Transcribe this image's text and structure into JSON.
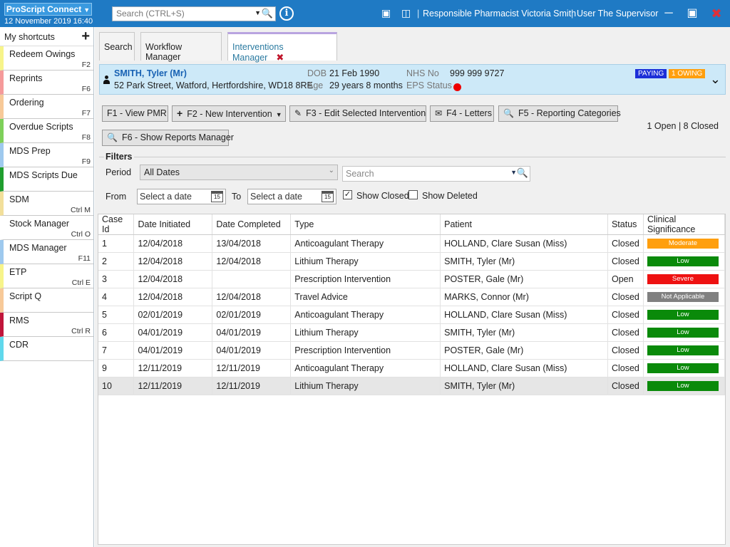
{
  "app": {
    "title": "ProScript Connect",
    "datetime": "12 November 2019 16:40"
  },
  "search": {
    "placeholder": "Search (CTRL+S)"
  },
  "header": {
    "pharmacist": "Responsible Pharmacist Victoria Smith",
    "user": "User The Supervisor"
  },
  "sidebar": {
    "title": "My shortcuts",
    "items": [
      {
        "label": "Redeem Owings",
        "key": "F2",
        "color": "#f7f48a"
      },
      {
        "label": "Reprints",
        "key": "F6",
        "color": "#f59a9a"
      },
      {
        "label": "Ordering",
        "key": "F7",
        "color": "#f7c998"
      },
      {
        "label": "Overdue Scripts",
        "key": "F8",
        "color": "#7ed05a"
      },
      {
        "label": "MDS Prep",
        "key": "F9",
        "color": "#9ec9ee"
      },
      {
        "label": "MDS Scripts Due",
        "key": "",
        "color": "#1f9e2e"
      },
      {
        "label": "SDM",
        "key": "Ctrl M",
        "color": "#f2df9a"
      },
      {
        "label": "Stock Manager",
        "key": "Ctrl O",
        "color": "#ffffff"
      },
      {
        "label": "MDS Manager",
        "key": "F11",
        "color": "#9ec9ee"
      },
      {
        "label": "ETP",
        "key": "Ctrl E",
        "color": "#f7f48a"
      },
      {
        "label": "Script Q",
        "key": "",
        "color": "#f7c998"
      },
      {
        "label": "RMS",
        "key": "Ctrl R",
        "color": "#c0153a"
      },
      {
        "label": "CDR",
        "key": "",
        "color": "#60d8ec"
      }
    ]
  },
  "tabs": [
    "Search",
    "Workflow Manager",
    "Interventions Manager"
  ],
  "patient": {
    "name": "SMITH, Tyler (Mr)",
    "address": "52 Park Street, Watford, Hertfordshire, WD18 8RE",
    "dob_label": "DOB",
    "dob": "21 Feb 1990",
    "age_label": "Age",
    "age": "29 years 8 months",
    "nhs_label": "NHS No",
    "nhs": "999 999 9727",
    "eps_label": "EPS Status",
    "badge_paying": "PAYING",
    "badge_owing": "1 OWING"
  },
  "toolbar": {
    "view_pmr": "F1 - View PMR",
    "new_intervention": "F2 - New Intervention",
    "edit": "F3 - Edit Selected Intervention",
    "letters": "F4 - Letters",
    "reporting": "F5 - Reporting Categories",
    "reports_manager": "F6 - Show Reports Manager",
    "counts": "1 Open | 8 Closed"
  },
  "filters": {
    "title": "Filters",
    "period_label": "Period",
    "period_value": "All Dates",
    "search_placeholder": "Search",
    "from_label": "From",
    "to_label": "To",
    "from_placeholder": "Select a date",
    "to_placeholder": "Select a date",
    "cal_day": "15",
    "show_closed": "Show Closed",
    "show_deleted": "Show Deleted"
  },
  "table": {
    "columns": [
      "Case Id",
      "Date Initiated",
      "Date Completed",
      "Type",
      "Patient",
      "Status",
      "Clinical Significance"
    ],
    "rows": [
      {
        "id": "1",
        "initiated": "12/04/2018",
        "completed": "13/04/2018",
        "type": "Anticoagulant Therapy",
        "patient": "HOLLAND, Clare Susan (Miss)",
        "status": "Closed",
        "sig": "Moderate",
        "sig_color": "#ff9f0e"
      },
      {
        "id": "2",
        "initiated": "12/04/2018",
        "completed": "12/04/2018",
        "type": "Lithium Therapy",
        "patient": "SMITH, Tyler (Mr)",
        "status": "Closed",
        "sig": "Low",
        "sig_color": "#0a8a0a"
      },
      {
        "id": "3",
        "initiated": "12/04/2018",
        "completed": "",
        "type": "Prescription Intervention",
        "patient": "POSTER, Gale (Mr)",
        "status": "Open",
        "sig": "Severe",
        "sig_color": "#ee1111"
      },
      {
        "id": "4",
        "initiated": "12/04/2018",
        "completed": "12/04/2018",
        "type": "Travel Advice",
        "patient": "MARKS, Connor (Mr)",
        "status": "Closed",
        "sig": "Not Applicable",
        "sig_color": "#808080"
      },
      {
        "id": "5",
        "initiated": "02/01/2019",
        "completed": "02/01/2019",
        "type": "Anticoagulant Therapy",
        "patient": "HOLLAND, Clare Susan (Miss)",
        "status": "Closed",
        "sig": "Low",
        "sig_color": "#0a8a0a"
      },
      {
        "id": "6",
        "initiated": "04/01/2019",
        "completed": "04/01/2019",
        "type": "Lithium Therapy",
        "patient": "SMITH, Tyler (Mr)",
        "status": "Closed",
        "sig": "Low",
        "sig_color": "#0a8a0a"
      },
      {
        "id": "7",
        "initiated": "04/01/2019",
        "completed": "04/01/2019",
        "type": "Prescription Intervention",
        "patient": "POSTER, Gale (Mr)",
        "status": "Closed",
        "sig": "Low",
        "sig_color": "#0a8a0a"
      },
      {
        "id": "9",
        "initiated": "12/11/2019",
        "completed": "12/11/2019",
        "type": "Anticoagulant Therapy",
        "patient": "HOLLAND, Clare Susan (Miss)",
        "status": "Closed",
        "sig": "Low",
        "sig_color": "#0a8a0a"
      },
      {
        "id": "10",
        "initiated": "12/11/2019",
        "completed": "12/11/2019",
        "type": "Lithium Therapy",
        "patient": "SMITH, Tyler (Mr)",
        "status": "Closed",
        "sig": "Low",
        "sig_color": "#0a8a0a"
      }
    ]
  }
}
